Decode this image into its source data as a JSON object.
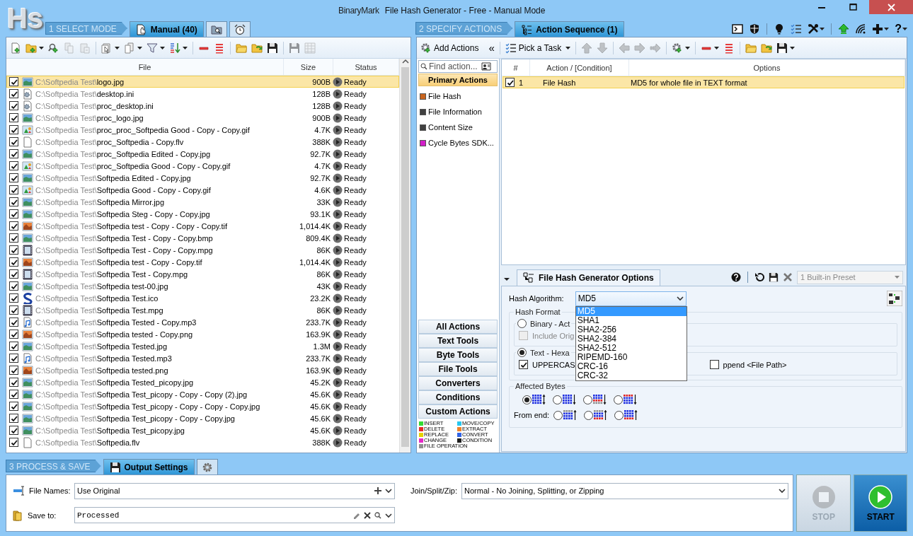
{
  "window": {
    "logo": "Hs",
    "brand": "BinaryMark",
    "title": "File Hash Generator - Free - Manual Mode"
  },
  "select_mode": {
    "step": "1 SELECT MODE",
    "tabs": [
      {
        "label": "Manual (40)",
        "kind": "hand-doc",
        "selected": true
      },
      {
        "kind": "folder-search",
        "selected": false
      },
      {
        "kind": "alarm",
        "selected": false
      }
    ]
  },
  "file_toolbar": [
    {
      "kind": "add-file",
      "has_menu": false,
      "disabled": false
    },
    {
      "kind": "add-folder",
      "has_menu": true,
      "disabled": false
    },
    {
      "kind": "find-add",
      "has_menu": false,
      "disabled": false
    },
    {
      "kind": "copy",
      "has_menu": false,
      "disabled": true
    },
    {
      "kind": "paste",
      "has_menu": false,
      "disabled": true
    },
    {
      "kind": "separator"
    },
    {
      "kind": "select",
      "has_menu": true,
      "disabled": false
    },
    {
      "kind": "docs",
      "has_menu": true,
      "disabled": false
    },
    {
      "kind": "filter",
      "has_menu": true,
      "disabled": false
    },
    {
      "kind": "sort",
      "has_menu": true,
      "disabled": false
    },
    {
      "kind": "separator"
    },
    {
      "kind": "remove",
      "has_menu": false,
      "disabled": false
    },
    {
      "kind": "remove-all",
      "has_menu": false,
      "disabled": false
    },
    {
      "kind": "separator"
    },
    {
      "kind": "folder-open",
      "has_menu": false,
      "disabled": false
    },
    {
      "kind": "folder-refresh",
      "has_menu": false,
      "disabled": false
    },
    {
      "kind": "save",
      "has_menu": false,
      "disabled": false
    },
    {
      "kind": "separator"
    },
    {
      "kind": "save",
      "has_menu": false,
      "disabled": true
    },
    {
      "kind": "grid",
      "has_menu": false,
      "disabled": true
    }
  ],
  "file_table": {
    "columns": [
      "File",
      "Size",
      "Status"
    ],
    "rows": [
      {
        "checked": true,
        "selected": true,
        "kind": "image",
        "folder": "C:\\Softpedia Test\\",
        "name": "logo.jpg",
        "size": "900B",
        "status": "Ready"
      },
      {
        "checked": true,
        "selected": false,
        "kind": "settings",
        "folder": "C:\\Softpedia Test\\",
        "name": "desktop.ini",
        "size": "128B",
        "status": "Ready"
      },
      {
        "checked": true,
        "selected": false,
        "kind": "settings",
        "folder": "C:\\Softpedia Test\\",
        "name": "proc_desktop.ini",
        "size": "128B",
        "status": "Ready"
      },
      {
        "checked": true,
        "selected": false,
        "kind": "image",
        "folder": "C:\\Softpedia Test\\",
        "name": "proc_logo.jpg",
        "size": "900B",
        "status": "Ready"
      },
      {
        "checked": true,
        "selected": false,
        "kind": "gif",
        "folder": "C:\\Softpedia Test\\",
        "name": "proc_proc_Softpedia Good - Copy - Copy.gif",
        "size": "4.7K",
        "status": "Ready"
      },
      {
        "checked": true,
        "selected": false,
        "kind": "blank",
        "folder": "C:\\Softpedia Test\\",
        "name": "proc_Softpedia - Copy.flv",
        "size": "388K",
        "status": "Ready"
      },
      {
        "checked": true,
        "selected": false,
        "kind": "image",
        "folder": "C:\\Softpedia Test\\",
        "name": "proc_Softpedia Edited - Copy.jpg",
        "size": "92.7K",
        "status": "Ready"
      },
      {
        "checked": true,
        "selected": false,
        "kind": "gif",
        "folder": "C:\\Softpedia Test\\",
        "name": "proc_Softpedia Good - Copy - Copy.gif",
        "size": "4.7K",
        "status": "Ready"
      },
      {
        "checked": true,
        "selected": false,
        "kind": "image",
        "folder": "C:\\Softpedia Test\\",
        "name": "Softpedia Edited - Copy.jpg",
        "size": "92.7K",
        "status": "Ready"
      },
      {
        "checked": true,
        "selected": false,
        "kind": "gif",
        "folder": "C:\\Softpedia Test\\",
        "name": "Softpedia Good - Copy - Copy.gif",
        "size": "4.6K",
        "status": "Ready"
      },
      {
        "checked": true,
        "selected": false,
        "kind": "image",
        "folder": "C:\\Softpedia Test\\",
        "name": "Softpedia Mirror.jpg",
        "size": "33K",
        "status": "Ready"
      },
      {
        "checked": true,
        "selected": false,
        "kind": "image",
        "folder": "C:\\Softpedia Test\\",
        "name": "Softpedia Steg - Copy - Copy.jpg",
        "size": "93.1K",
        "status": "Ready"
      },
      {
        "checked": true,
        "selected": false,
        "kind": "photo",
        "folder": "C:\\Softpedia Test\\",
        "name": "Softpedia test - Copy - Copy - Copy.tif",
        "size": "1,014.4K",
        "status": "Ready"
      },
      {
        "checked": true,
        "selected": false,
        "kind": "image",
        "folder": "C:\\Softpedia Test\\",
        "name": "Softpedia Test - Copy - Copy.bmp",
        "size": "809.4K",
        "status": "Ready"
      },
      {
        "checked": true,
        "selected": false,
        "kind": "video",
        "folder": "C:\\Softpedia Test\\",
        "name": "Softpedia Test - Copy - Copy.mpg",
        "size": "86K",
        "status": "Ready"
      },
      {
        "checked": true,
        "selected": false,
        "kind": "photo",
        "folder": "C:\\Softpedia Test\\",
        "name": "Softpedia test - Copy - Copy.tif",
        "size": "1,014.4K",
        "status": "Ready"
      },
      {
        "checked": true,
        "selected": false,
        "kind": "video",
        "folder": "C:\\Softpedia Test\\",
        "name": "Softpedia Test - Copy.mpg",
        "size": "86K",
        "status": "Ready"
      },
      {
        "checked": true,
        "selected": false,
        "kind": "image",
        "folder": "C:\\Softpedia Test\\",
        "name": "Softpedia test-00.jpg",
        "size": "43K",
        "status": "Ready"
      },
      {
        "checked": true,
        "selected": false,
        "kind": "swirl",
        "folder": "C:\\Softpedia Test\\",
        "name": "Softpedia Test.ico",
        "size": "23.2K",
        "status": "Ready"
      },
      {
        "checked": true,
        "selected": false,
        "kind": "video",
        "folder": "C:\\Softpedia Test\\",
        "name": "Softpedia Test.mpg",
        "size": "86K",
        "status": "Ready"
      },
      {
        "checked": true,
        "selected": false,
        "kind": "audio",
        "folder": "C:\\Softpedia Test\\",
        "name": "Softpedia Tested - Copy.mp3",
        "size": "233.7K",
        "status": "Ready"
      },
      {
        "checked": true,
        "selected": false,
        "kind": "photo",
        "folder": "C:\\Softpedia Test\\",
        "name": "Softpedia tested - Copy.png",
        "size": "163.9K",
        "status": "Ready"
      },
      {
        "checked": true,
        "selected": false,
        "kind": "image",
        "folder": "C:\\Softpedia Test\\",
        "name": "Softpedia Tested.jpg",
        "size": "1.3M",
        "status": "Ready"
      },
      {
        "checked": true,
        "selected": false,
        "kind": "audio",
        "folder": "C:\\Softpedia Test\\",
        "name": "Softpedia Tested.mp3",
        "size": "233.7K",
        "status": "Ready"
      },
      {
        "checked": true,
        "selected": false,
        "kind": "photo",
        "folder": "C:\\Softpedia Test\\",
        "name": "Softpedia tested.png",
        "size": "163.9K",
        "status": "Ready"
      },
      {
        "checked": true,
        "selected": false,
        "kind": "image",
        "folder": "C:\\Softpedia Test\\",
        "name": "Softpedia Tested_picopy.jpg",
        "size": "45.2K",
        "status": "Ready"
      },
      {
        "checked": true,
        "selected": false,
        "kind": "image",
        "folder": "C:\\Softpedia Test\\",
        "name": "Softpedia Test_picopy - Copy - Copy (2).jpg",
        "size": "45.6K",
        "status": "Ready"
      },
      {
        "checked": true,
        "selected": false,
        "kind": "image",
        "folder": "C:\\Softpedia Test\\",
        "name": "Softpedia Test_picopy - Copy - Copy - Copy.jpg",
        "size": "45.6K",
        "status": "Ready"
      },
      {
        "checked": true,
        "selected": false,
        "kind": "image",
        "folder": "C:\\Softpedia Test\\",
        "name": "Softpedia Test_picopy - Copy - Copy.jpg",
        "size": "45.6K",
        "status": "Ready"
      },
      {
        "checked": true,
        "selected": false,
        "kind": "image",
        "folder": "C:\\Softpedia Test\\",
        "name": "Softpedia Test_picopy.jpg",
        "size": "45.6K",
        "status": "Ready"
      },
      {
        "checked": true,
        "selected": false,
        "kind": "blank",
        "folder": "C:\\Softpedia Test\\",
        "name": "Softpedia.flv",
        "size": "388K",
        "status": "Ready"
      }
    ]
  },
  "specify_actions": {
    "step": "2 SPECIFY ACTIONS",
    "tabs": [
      {
        "label": "Action Sequence (1)",
        "kind": "sequence",
        "selected": true
      }
    ]
  },
  "app_toolbar": [
    {
      "kind": "terminal",
      "has_menu": false
    },
    {
      "kind": "shield",
      "has_menu": false
    },
    {
      "kind": "separator"
    },
    {
      "kind": "bulb",
      "has_menu": false
    },
    {
      "kind": "checklist",
      "has_menu": false
    },
    {
      "kind": "tools",
      "has_menu": true
    },
    {
      "kind": "separator"
    },
    {
      "kind": "upload",
      "has_menu": false
    },
    {
      "kind": "wifi",
      "has_menu": false
    },
    {
      "kind": "plus",
      "has_menu": true
    },
    {
      "kind": "help",
      "label": "?",
      "has_menu": true
    }
  ],
  "actions_toolbar": [
    {
      "kind": "gear-add",
      "label": "Add Actions",
      "has_menu": false,
      "disabled": false
    },
    {
      "kind": "collapse",
      "label": "«",
      "has_menu": false,
      "disabled": false
    },
    {
      "kind": "separator"
    },
    {
      "kind": "checklist",
      "label": "Pick a Task",
      "has_menu": true,
      "disabled": false
    },
    {
      "kind": "separator"
    },
    {
      "kind": "up",
      "has_menu": false,
      "disabled": true
    },
    {
      "kind": "down",
      "has_menu": false,
      "disabled": true
    },
    {
      "kind": "separator"
    },
    {
      "kind": "left",
      "has_menu": false,
      "disabled": true
    },
    {
      "kind": "right",
      "has_menu": false,
      "disabled": true
    },
    {
      "kind": "skip",
      "has_menu": false,
      "disabled": true
    },
    {
      "kind": "separator"
    },
    {
      "kind": "gear-add",
      "has_menu": true,
      "disabled": false
    },
    {
      "kind": "separator"
    },
    {
      "kind": "remove",
      "has_menu": true,
      "disabled": false
    },
    {
      "kind": "remove-all",
      "has_menu": false,
      "disabled": false
    },
    {
      "kind": "separator"
    },
    {
      "kind": "folder-open",
      "has_menu": false,
      "disabled": false
    },
    {
      "kind": "folder-refresh",
      "has_menu": false,
      "disabled": false
    },
    {
      "kind": "save",
      "has_menu": true,
      "disabled": false
    }
  ],
  "action_library": {
    "search_placeholder": "Find action...",
    "primary": {
      "label": "Primary Actions",
      "selected": true
    },
    "items": [
      {
        "label": "File Hash",
        "color": "#c8641e"
      },
      {
        "label": "File Information",
        "color": "#404040"
      },
      {
        "label": "Content Size",
        "color": "#404040"
      },
      {
        "label": "Cycle Bytes SDK...",
        "color": "#d21ec8"
      }
    ],
    "categories": [
      {
        "label": "All Actions",
        "selected": false
      },
      {
        "label": "Text Tools",
        "selected": false
      },
      {
        "label": "Byte Tools",
        "selected": false
      },
      {
        "label": "File Tools",
        "selected": false
      },
      {
        "label": "Converters",
        "selected": false
      },
      {
        "label": "Conditions",
        "selected": false
      },
      {
        "label": "Custom Actions",
        "selected": false
      }
    ],
    "legend": [
      {
        "label": "INSERT",
        "color": "#32dc32"
      },
      {
        "label": "MOVE/COPY",
        "color": "#28c8f0"
      },
      {
        "label": "DELETE",
        "color": "#e62828"
      },
      {
        "label": "EXTRACT",
        "color": "#f08228"
      },
      {
        "label": "REPLACE",
        "color": "#e6d200"
      },
      {
        "label": "CONVERT",
        "color": "#3264e6"
      },
      {
        "label": "CHANGE",
        "color": "#e628c8"
      },
      {
        "label": "CONDITION",
        "color": "#1e1e1e"
      },
      {
        "label": "FILE OPERATION",
        "color": "#909090"
      }
    ]
  },
  "sequence_table": {
    "columns": [
      "#",
      "Action / [Condition]",
      "Options"
    ],
    "rows": [
      {
        "checked": true,
        "selected": true,
        "number": "1",
        "action": "File Hash",
        "options": "MD5 for whole file in TEXT format"
      }
    ]
  },
  "options_panel": {
    "expanded": true,
    "tab": "File Hash Generator Options",
    "preset": {
      "value": "1 Built-in Preset",
      "disabled": true
    },
    "hash_algorithm": {
      "label": "Hash Algorithm:",
      "value": "MD5",
      "open": true,
      "options": [
        {
          "label": "MD5",
          "selected": true
        },
        {
          "label": "SHA1",
          "selected": false
        },
        {
          "label": "SHA2-256",
          "selected": false
        },
        {
          "label": "SHA2-384",
          "selected": false
        },
        {
          "label": "SHA2-512",
          "selected": false
        },
        {
          "label": "RIPEMD-160",
          "selected": false
        },
        {
          "label": "CRC-16",
          "selected": false
        },
        {
          "label": "CRC-32",
          "selected": false
        }
      ]
    },
    "hash_format": {
      "title": "Hash Format",
      "options": [
        {
          "label": "Binary - Act",
          "selected": false,
          "sub": [
            {
              "label": "Include Orig",
              "checked": false,
              "disabled": true
            }
          ]
        },
        {
          "label": "Text - Hexa",
          "selected": true,
          "sub": [
            {
              "label": "UPPERCAS",
              "checked": true,
              "disabled": false
            },
            {
              "label": "ppend <File Path>",
              "checked": false,
              "disabled": false
            }
          ]
        }
      ]
    },
    "affected_bytes": {
      "title": "Affected Bytes",
      "from_start": [
        {
          "kind": "whole",
          "selected": true
        },
        {
          "kind": "start",
          "selected": false
        },
        {
          "kind": "start-marked",
          "selected": false
        },
        {
          "kind": "head-marked",
          "selected": false
        }
      ],
      "from_end_label": "From end:",
      "from_end": [
        {
          "kind": "end",
          "selected": false
        },
        {
          "kind": "end-marked",
          "selected": false
        },
        {
          "kind": "tail-marked",
          "selected": false
        }
      ]
    }
  },
  "process_save": {
    "step": "3 PROCESS & SAVE",
    "tabs": [
      {
        "label": "Output Settings",
        "kind": "save",
        "selected": true
      },
      {
        "kind": "gear",
        "selected": false
      }
    ],
    "file_names": {
      "label": "File Names:",
      "value": "Use Original"
    },
    "save_to": {
      "label": "Save to:",
      "value": "Processed"
    },
    "join": {
      "label": "Join/Split/Zip:",
      "value": "Normal - No Joining, Splitting, or Zipping"
    },
    "stop": {
      "label": "STOP",
      "disabled": true
    },
    "start": {
      "label": "START",
      "disabled": false
    }
  }
}
